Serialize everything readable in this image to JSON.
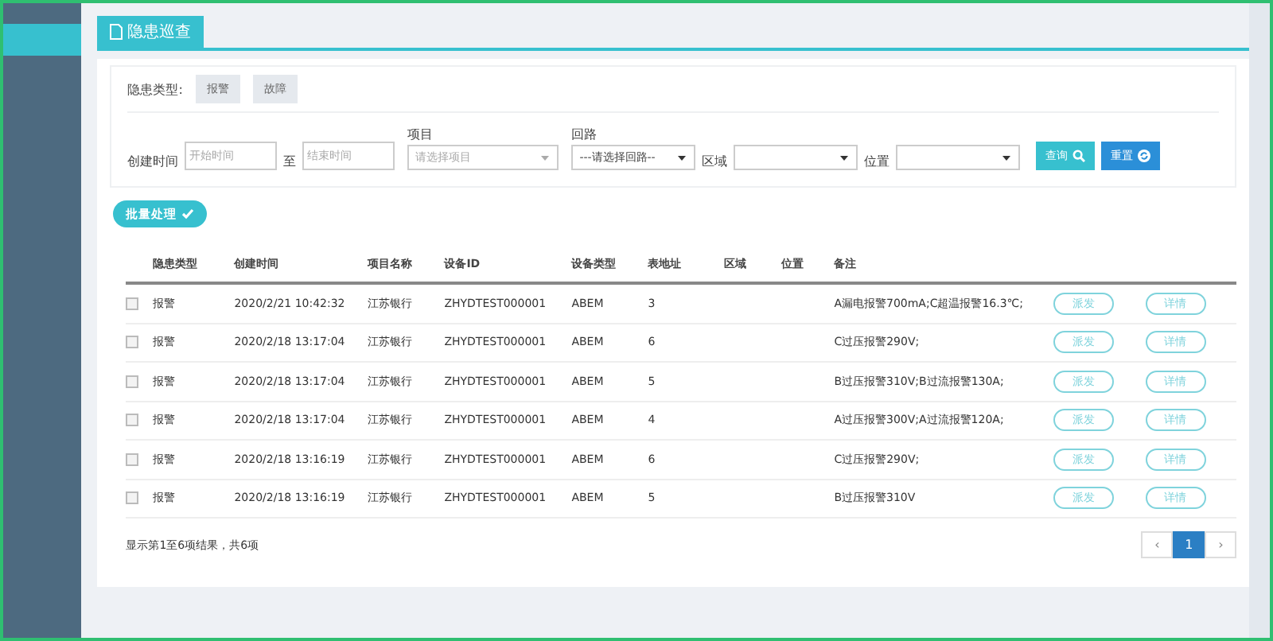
{
  "tab": {
    "label": "隐患巡查",
    "selected": true
  },
  "hazard_type": {
    "label": "隐患类型:",
    "options": [
      {
        "label": "报警",
        "selected": false
      },
      {
        "label": "故障",
        "selected": false
      }
    ]
  },
  "filters": {
    "created_label": "创建时间",
    "start_placeholder": "开始时间",
    "to_label": "至",
    "end_placeholder": "结束时间",
    "project_label": "项目",
    "project_placeholder": "请选择项目",
    "circuit_label": "回路",
    "circuit_value": "---请选择回路--",
    "area_label": "区域",
    "position_label": "位置",
    "query_button": "查询",
    "reset_button": "重置"
  },
  "batch_button": "批量处理",
  "table": {
    "columns": [
      "隐患类型",
      "创建时间",
      "项目名称",
      "设备ID",
      "设备类型",
      "表地址",
      "区域",
      "位置",
      "备注"
    ],
    "rows": [
      {
        "checked": false,
        "cells": [
          "报警",
          "2020/2/21 10:42:32",
          "江苏银行",
          "ZHYDTEST000001",
          "ABEM",
          "3",
          "",
          "",
          "A漏电报警700mA;C超温报警16.3℃;"
        ],
        "actions": [
          "派发",
          "详情"
        ]
      },
      {
        "checked": false,
        "cells": [
          "报警",
          "2020/2/18 13:17:04",
          "江苏银行",
          "ZHYDTEST000001",
          "ABEM",
          "6",
          "",
          "",
          "C过压报警290V;"
        ],
        "actions": [
          "派发",
          "详情"
        ]
      },
      {
        "checked": false,
        "cells": [
          "报警",
          "2020/2/18 13:17:04",
          "江苏银行",
          "ZHYDTEST000001",
          "ABEM",
          "5",
          "",
          "",
          "B过压报警310V;B过流报警130A;"
        ],
        "actions": [
          "派发",
          "详情"
        ]
      },
      {
        "checked": false,
        "cells": [
          "报警",
          "2020/2/18 13:17:04",
          "江苏银行",
          "ZHYDTEST000001",
          "ABEM",
          "4",
          "",
          "",
          "A过压报警300V;A过流报警120A;"
        ],
        "actions": [
          "派发",
          "详情"
        ]
      },
      {
        "checked": false,
        "cells": [
          "报警",
          "2020/2/18 13:16:19",
          "江苏银行",
          "ZHYDTEST000001",
          "ABEM",
          "6",
          "",
          "",
          "C过压报警290V;"
        ],
        "actions": [
          "派发",
          "详情"
        ]
      },
      {
        "checked": false,
        "cells": [
          "报警",
          "2020/2/18 13:16:19",
          "江苏银行",
          "ZHYDTEST000001",
          "ABEM",
          "5",
          "",
          "",
          "B过压报警310V"
        ],
        "actions": [
          "派发",
          "详情"
        ]
      }
    ]
  },
  "summary": "显示第1至6项结果，共6项",
  "pagination": {
    "prev": "‹",
    "next": "›",
    "pages": [
      {
        "label": "1",
        "selected": true
      }
    ]
  }
}
